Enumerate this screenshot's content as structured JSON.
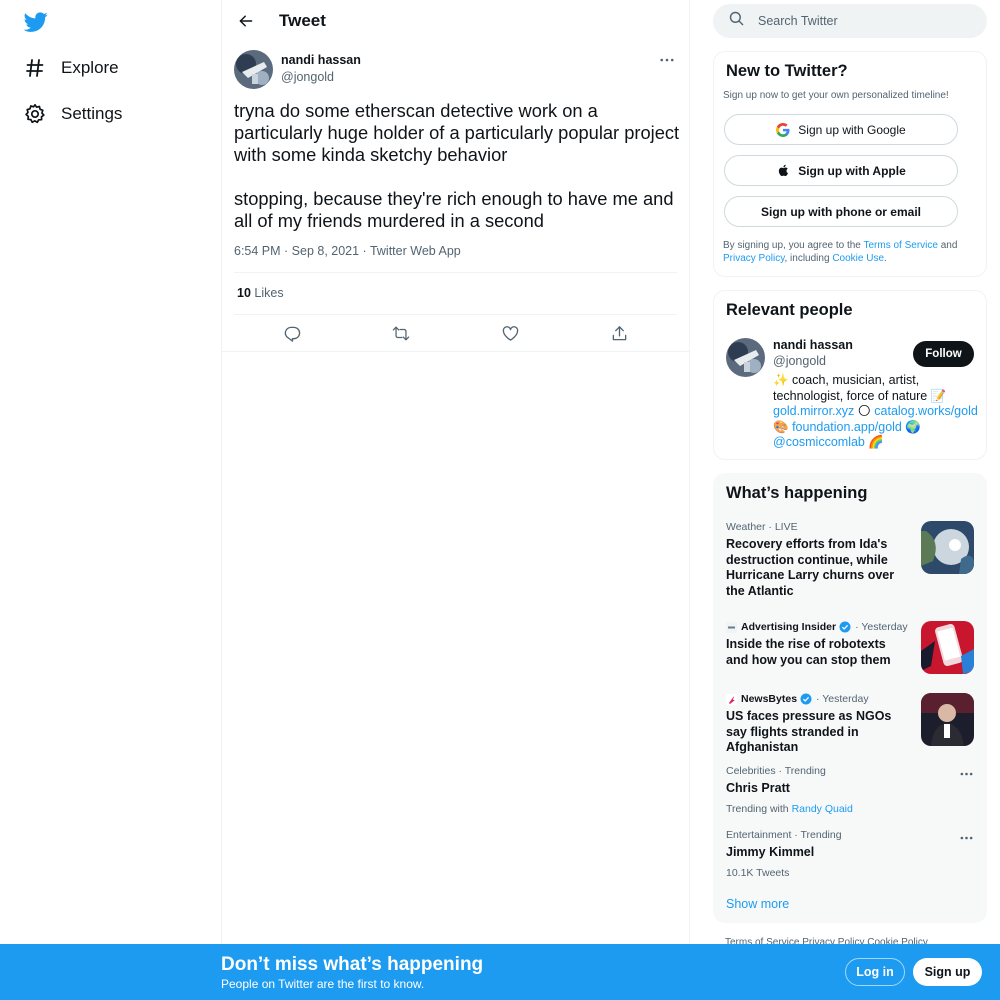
{
  "nav": {
    "logo_icon": "twitter-bird-icon",
    "items": [
      {
        "label": "Explore",
        "icon": "hashtag-icon"
      },
      {
        "label": "Settings",
        "icon": "gear-icon"
      }
    ]
  },
  "header": {
    "title": "Tweet"
  },
  "tweet": {
    "author_name": "nandi hassan",
    "author_handle": "@jongold",
    "paragraph1": "tryna do some etherscan detective work on a particularly huge holder of a particularly popular project with some kinda sketchy behavior",
    "paragraph2": "stopping, because they're rich enough to have me and all of my friends murdered in a second",
    "meta": "6:54 PM · Sep 8, 2021 · Twitter Web App",
    "likes_count": "10",
    "likes_label": "Likes"
  },
  "search": {
    "placeholder": "Search Twitter"
  },
  "new_to_twitter": {
    "title": "New to Twitter?",
    "subtitle": "Sign up now to get your own personalized timeline!",
    "google_label": "Sign up with Google",
    "apple_label": "Sign up with Apple",
    "phone_label": "Sign up with phone or email",
    "legal_prefix": "By signing up, you agree to the ",
    "terms_link": "Terms of Service",
    "legal_and": " and ",
    "privacy_link": "Privacy Policy",
    "legal_including": ", including ",
    "cookie_link": "Cookie Use",
    "legal_end": "."
  },
  "relevant_people": {
    "title": "Relevant people",
    "name": "nandi hassan",
    "handle": "@jongold",
    "follow_label": "Follow",
    "bio_sparkle": "✨",
    "bio_text": " coach, musician, artist, technologist, force of nature ",
    "bio_memo": "📝",
    "bio_link1": "gold.mirror.xyz",
    "bio_sun": "🌕",
    "bio_link2": "catalog.works/gold",
    "bio_palette": "🎨",
    "bio_link3": "foundation.app/gold",
    "bio_globe": "🌍",
    "bio_link4": "@cosmiccomlab",
    "bio_rainbow": "🌈"
  },
  "whats_happening": {
    "title": "What’s happening",
    "trends": [
      {
        "context": "Weather · LIVE",
        "headline": "Recovery efforts from Ida's destruction continue, while Hurricane Larry churns over the Atlantic"
      },
      {
        "source": "Advertising Insider",
        "time": "· Yesterday",
        "headline": "Inside the rise of robotexts and how you can stop them"
      },
      {
        "source": "NewsBytes",
        "time": "· Yesterday",
        "headline": "US faces pressure as NGOs say flights stranded in Afghanistan"
      },
      {
        "context": "Celebrities · Trending",
        "headline": "Chris Pratt",
        "extra_prefix": "Trending with ",
        "extra_link": "Randy Quaid"
      },
      {
        "context": "Entertainment · Trending",
        "headline": "Jimmy Kimmel",
        "extra": "10.1K Tweets"
      }
    ],
    "show_more": "Show more"
  },
  "footer": {
    "links": "Terms of Service   Privacy Policy   Cookie Policy"
  },
  "banner": {
    "title": "Don’t miss what’s happening",
    "subtitle": "People on Twitter are the first to know.",
    "login_label": "Log in",
    "signup_label": "Sign up"
  },
  "colors": {
    "brand": "#1d9bf0",
    "text": "#0f1419",
    "muted": "#536471"
  }
}
